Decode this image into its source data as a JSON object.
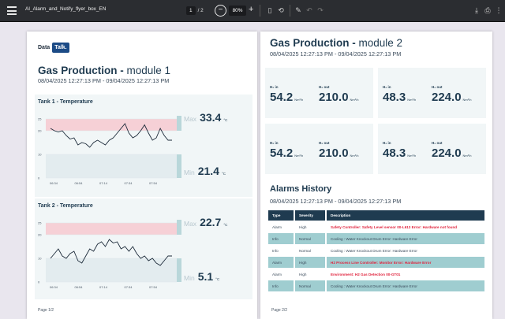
{
  "toolbar": {
    "title": "AI_Alarm_and_Notify_flyer_box_EN",
    "page_current": "1",
    "page_total": "/ 2",
    "zoom": "80%",
    "minus": "−",
    "plus": "+",
    "icons": [
      "menu-icon",
      "fit-page-icon",
      "rotate-icon",
      "draw-icon",
      "undo-icon",
      "redo-icon",
      "download-icon",
      "print-icon",
      "more-icon"
    ]
  },
  "page1": {
    "logo_text": "Data",
    "logo_badge": "Talk.",
    "title_bold": "Gas Production -",
    "title_rest": " module 1",
    "date_range": "08/04/2025 12:27:13 PM - 09/04/2025 12:27:13 PM",
    "footer": "Page 1/2",
    "tanks": [
      {
        "title": "Tank 1 - Temperature",
        "y_ticks": [
          "25",
          "20",
          "10",
          "0"
        ],
        "x_ticks": [
          "06:34",
          "06:54",
          "07:14",
          "07:34",
          "07:54"
        ],
        "max_label": "Max",
        "max_value": "33.4",
        "min_label": "Min",
        "min_value": "21.4",
        "unit": "°C"
      },
      {
        "title": "Tank 2 - Temperature",
        "y_ticks": [
          "25",
          "20",
          "10",
          "0"
        ],
        "x_ticks": [
          "06:34",
          "06:54",
          "07:14",
          "07:34",
          "07:54"
        ],
        "max_label": "Max",
        "max_value": "22.7",
        "min_label": "Min",
        "min_value": "5.1",
        "unit": "°C"
      }
    ]
  },
  "page2": {
    "title_bold": "Gas Production -",
    "title_rest": " module 2",
    "date_range": "08/04/2025 12:27:13 PM - 09/04/2025 12:27:13 PM",
    "footer": "Page 2/2",
    "cards": [
      {
        "in_label": "H₂ in",
        "in_value": "54.2",
        "out_label": "H₂ out",
        "out_value": "210.0",
        "unit": "Nm³/h"
      },
      {
        "in_label": "H₂ in",
        "in_value": "48.3",
        "out_label": "H₂ out",
        "out_value": "224.0",
        "unit": "Nm³/h"
      },
      {
        "in_label": "H₂ in",
        "in_value": "54.2",
        "out_label": "H₂ out",
        "out_value": "210.0",
        "unit": "Nm³/h"
      },
      {
        "in_label": "H₂ in",
        "in_value": "48.3",
        "out_label": "H₂ out",
        "out_value": "224.0",
        "unit": "Nm³/h"
      }
    ],
    "alarms_title": "Alarms History",
    "alarms_date": "08/04/2025 12:27:13 PM - 09/04/2025 12:27:13 PM",
    "alarm_headers": [
      "Type",
      "Severity",
      "Description"
    ],
    "alarms": [
      {
        "type": "Alarm",
        "severity": "High",
        "desc": "Safety Controller: Safety Level sensor 00-L613 Error: Hardware not found",
        "red": true,
        "hl": false
      },
      {
        "type": "Info",
        "severity": "Normal",
        "desc": "Cooling : Water Knockout Drum Error: Hardware Error",
        "red": false,
        "hl": true
      },
      {
        "type": "Info",
        "severity": "Normal",
        "desc": "Cooling : Water Knockout Drum Error: Hardware Error",
        "red": false,
        "hl": false
      },
      {
        "type": "Alarm",
        "severity": "High",
        "desc": "H2 Process Line Controller: Monitor Error: Hardware Error",
        "red": true,
        "hl": true
      },
      {
        "type": "Alarm",
        "severity": "High",
        "desc": "Environment: H2 Gas Detection 00-GT01",
        "red": true,
        "hl": false
      },
      {
        "type": "Info",
        "severity": "Normal",
        "desc": "Cooling : Water Knockout Drum Error: Hardware Error",
        "red": false,
        "hl": true
      }
    ]
  },
  "chart_data": [
    {
      "type": "line",
      "title": "Tank 1 - Temperature",
      "x": [
        "06:34",
        "06:54",
        "07:14",
        "07:34",
        "07:54"
      ],
      "ylim": [
        0,
        28
      ],
      "high_band": [
        20,
        25
      ],
      "low_band": [
        0,
        10
      ],
      "colors": {
        "line": "#1d2b3a",
        "high": "#f6d0d6",
        "low": "#e3ecef"
      },
      "series": [
        {
          "values": [
            21,
            20,
            19.5,
            20,
            18,
            16.5,
            17,
            14,
            15,
            14.5,
            13,
            15,
            16,
            15,
            14,
            16,
            17,
            19,
            21,
            23,
            19,
            17,
            18,
            20,
            22.5,
            19,
            16,
            17,
            21,
            18,
            16,
            16
          ]
        }
      ]
    },
    {
      "type": "line",
      "title": "Tank 2 - Temperature",
      "x": [
        "06:34",
        "06:54",
        "07:14",
        "07:34",
        "07:54"
      ],
      "ylim": [
        0,
        28
      ],
      "high_band": [
        20,
        25
      ],
      "low_band": [
        0,
        10
      ],
      "colors": {
        "line": "#1d2b3a",
        "high": "#f6d0d6",
        "low": "#e3ecef"
      },
      "series": [
        {
          "values": [
            10,
            12,
            14,
            11,
            10,
            12,
            13,
            9,
            8,
            11,
            14,
            13,
            16,
            17,
            15,
            18,
            16.5,
            17,
            14,
            15,
            13,
            15,
            12,
            10,
            11,
            9,
            10,
            8,
            7,
            9,
            11,
            11
          ]
        }
      ]
    }
  ]
}
